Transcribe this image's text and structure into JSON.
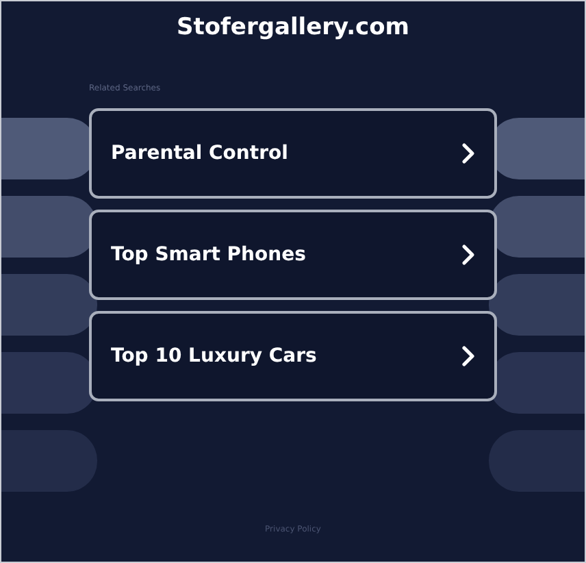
{
  "site_title": "Stofergallery.com",
  "section_label": "Related Searches",
  "links": [
    {
      "label": "Parental Control"
    },
    {
      "label": "Top Smart Phones"
    },
    {
      "label": "Top 10 Luxury Cars"
    }
  ],
  "footer_link": "Privacy Policy"
}
